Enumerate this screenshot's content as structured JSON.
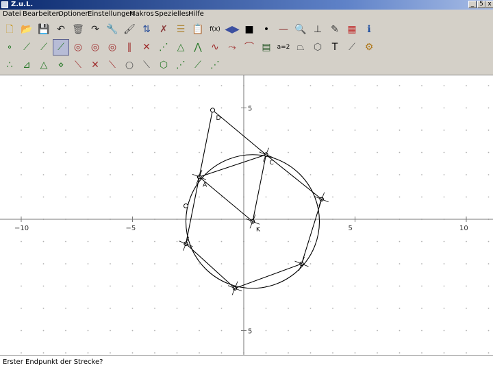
{
  "window": {
    "title": "Z.u.L."
  },
  "window_buttons": [
    "_",
    "5",
    "x"
  ],
  "menu": [
    "Datei",
    "Bearbeiten",
    "Optionen",
    "Einstellungen",
    "Makros",
    "Spezielles",
    "Hilfe"
  ],
  "toolbar": {
    "row1": [
      {
        "name": "new-file-icon",
        "glyph": "🗋",
        "color": "#c89b2a"
      },
      {
        "name": "open-folder-icon",
        "glyph": "📂",
        "color": "#c89b2a"
      },
      {
        "name": "save-icon",
        "glyph": "💾",
        "color": "#5b5ea6"
      },
      {
        "name": "undo-icon",
        "glyph": "↶",
        "color": "#222"
      },
      {
        "name": "delete-icon",
        "glyph": "🗑",
        "color": "#555"
      },
      {
        "name": "redo-icon",
        "glyph": "↷",
        "color": "#222"
      },
      {
        "name": "edit-icon",
        "glyph": "🔧",
        "color": "#555"
      },
      {
        "name": "paint-icon",
        "glyph": "🖌",
        "color": "#444"
      },
      {
        "name": "sort-icon",
        "glyph": "⇅",
        "color": "#2a4f9a"
      },
      {
        "name": "hide-icon",
        "glyph": "✗",
        "color": "#8a3a3a"
      },
      {
        "name": "macro-icon",
        "glyph": "☰",
        "color": "#b0893b"
      },
      {
        "name": "clipboard-icon",
        "glyph": "📋",
        "color": "#8a6d3b"
      },
      {
        "name": "function-icon",
        "glyph": "f(x)",
        "color": "#000"
      },
      {
        "name": "arrows-icon",
        "glyph": "◀▶",
        "color": "#3b4fa0"
      },
      {
        "name": "black-square-icon",
        "glyph": "■",
        "color": "#000"
      },
      {
        "name": "dot-icon",
        "glyph": "•",
        "color": "#000"
      },
      {
        "name": "line-thickness-icon",
        "glyph": "—",
        "color": "#8a2a2a"
      },
      {
        "name": "zoom-icon",
        "glyph": "🔍",
        "color": "#333"
      },
      {
        "name": "angle-icon",
        "glyph": "⊥",
        "color": "#333"
      },
      {
        "name": "draw-icon",
        "glyph": "✎",
        "color": "#333"
      },
      {
        "name": "colors-icon",
        "glyph": "▦",
        "color": "#c03030"
      },
      {
        "name": "info-icon",
        "glyph": "ℹ",
        "color": "#1f4fa0"
      }
    ],
    "row2": [
      {
        "name": "point-tool-icon",
        "glyph": "∘",
        "color": "#2a7a2a"
      },
      {
        "name": "segment-tool-icon",
        "glyph": "⟋",
        "color": "#2a7a2a"
      },
      {
        "name": "line-tool-icon",
        "glyph": "⟋",
        "color": "#2a7a2a"
      },
      {
        "name": "ray-tool-icon",
        "glyph": "⟋",
        "color": "#2a7a2a",
        "active": true
      },
      {
        "name": "circle-tool-icon",
        "glyph": "◎",
        "color": "#a03030"
      },
      {
        "name": "circle-radius-icon",
        "glyph": "◎",
        "color": "#a03030"
      },
      {
        "name": "circle-three-points-icon",
        "glyph": "◎",
        "color": "#a03030"
      },
      {
        "name": "parallel-icon",
        "glyph": "∥",
        "color": "#a03030"
      },
      {
        "name": "perpendicular-icon",
        "glyph": "✕",
        "color": "#a03030"
      },
      {
        "name": "midpoint-icon",
        "glyph": "⋰",
        "color": "#2a7a2a"
      },
      {
        "name": "triangle-icon",
        "glyph": "△",
        "color": "#2a7a2a"
      },
      {
        "name": "bisector-icon",
        "glyph": "⋀",
        "color": "#2a7a2a"
      },
      {
        "name": "curve-icon",
        "glyph": "∿",
        "color": "#a03030"
      },
      {
        "name": "transform-icon",
        "glyph": "⤳",
        "color": "#a03030"
      },
      {
        "name": "arc-icon",
        "glyph": "⌒",
        "color": "#a03030"
      },
      {
        "name": "film-icon",
        "glyph": "▤",
        "color": "#2a5a2a"
      },
      {
        "name": "equation-icon",
        "glyph": "a=2",
        "color": "#000"
      },
      {
        "name": "polygon-icon",
        "glyph": "⏢",
        "color": "#555"
      },
      {
        "name": "ring-icon",
        "glyph": "⬡",
        "color": "#555"
      },
      {
        "name": "text-icon",
        "glyph": "T",
        "color": "#000"
      },
      {
        "name": "wand-icon",
        "glyph": "⟋",
        "color": "#555"
      },
      {
        "name": "gear-icon",
        "glyph": "⚙",
        "color": "#b07a20"
      }
    ],
    "row3": [
      {
        "name": "macro-point-icon",
        "glyph": "∴",
        "color": "#2a7a2a"
      },
      {
        "name": "macro-arrow-icon",
        "glyph": "⊿",
        "color": "#2a7a2a"
      },
      {
        "name": "macro-triangle-icon",
        "glyph": "△",
        "color": "#2a7a2a"
      },
      {
        "name": "macro-rhombus-icon",
        "glyph": "⋄",
        "color": "#2a7a2a"
      },
      {
        "name": "macro-diagonal-icon",
        "glyph": "⟍",
        "color": "#a03030"
      },
      {
        "name": "macro-cross-icon",
        "glyph": "✕",
        "color": "#a03030"
      },
      {
        "name": "macro-intersect-icon",
        "glyph": "⟍",
        "color": "#a03030"
      },
      {
        "name": "macro-circle-icon",
        "glyph": "○",
        "color": "#555"
      },
      {
        "name": "macro-slash-icon",
        "glyph": "⟍",
        "color": "#555"
      },
      {
        "name": "macro-hexagon-icon",
        "glyph": "⬡",
        "color": "#2a7a2a"
      },
      {
        "name": "macro-fan-icon",
        "glyph": "⋰",
        "color": "#2a7a2a"
      },
      {
        "name": "macro-segment-icon",
        "glyph": "⟋",
        "color": "#2a7a2a"
      },
      {
        "name": "macro-chain-icon",
        "glyph": "⋰",
        "color": "#2a7a2a"
      }
    ]
  },
  "axis": {
    "x_ticks": [
      {
        "value": -10,
        "label": "−10"
      },
      {
        "value": -5,
        "label": "−5"
      },
      {
        "value": 5,
        "label": "5"
      },
      {
        "value": 10,
        "label": "10"
      }
    ],
    "y_ticks": [
      {
        "value": 5,
        "label": "5"
      },
      {
        "value": -5,
        "label": "5"
      }
    ]
  },
  "points": {
    "D": {
      "label": "D",
      "x": -1.4,
      "y": 4.9
    },
    "C": {
      "label": "C",
      "x": 1.0,
      "y": 2.9
    },
    "A": {
      "label": "A",
      "x": -2.0,
      "y": 1.9
    },
    "K": {
      "label": "K",
      "x": 0.4,
      "y": -0.1
    },
    "R": {
      "label": "",
      "x": 3.5,
      "y": 0.9
    },
    "Q": {
      "label": "",
      "x": 2.6,
      "y": -2.0
    },
    "P": {
      "label": "",
      "x": -0.4,
      "y": -3.1
    },
    "S": {
      "label": "",
      "x": -2.6,
      "y": -1.1
    },
    "O": {
      "label": "",
      "x": -2.6,
      "y": 0.6
    }
  },
  "circle": {
    "center": "K",
    "radius": 3.0
  },
  "segments": [
    [
      "D",
      "C"
    ],
    [
      "D",
      "A"
    ],
    [
      "A",
      "C"
    ],
    [
      "A",
      "K"
    ],
    [
      "C",
      "K"
    ],
    [
      "C",
      "R"
    ],
    [
      "R",
      "Q"
    ],
    [
      "Q",
      "P"
    ],
    [
      "P",
      "S"
    ],
    [
      "S",
      "A"
    ]
  ],
  "status": "Erster Endpunkt der Strecke?"
}
